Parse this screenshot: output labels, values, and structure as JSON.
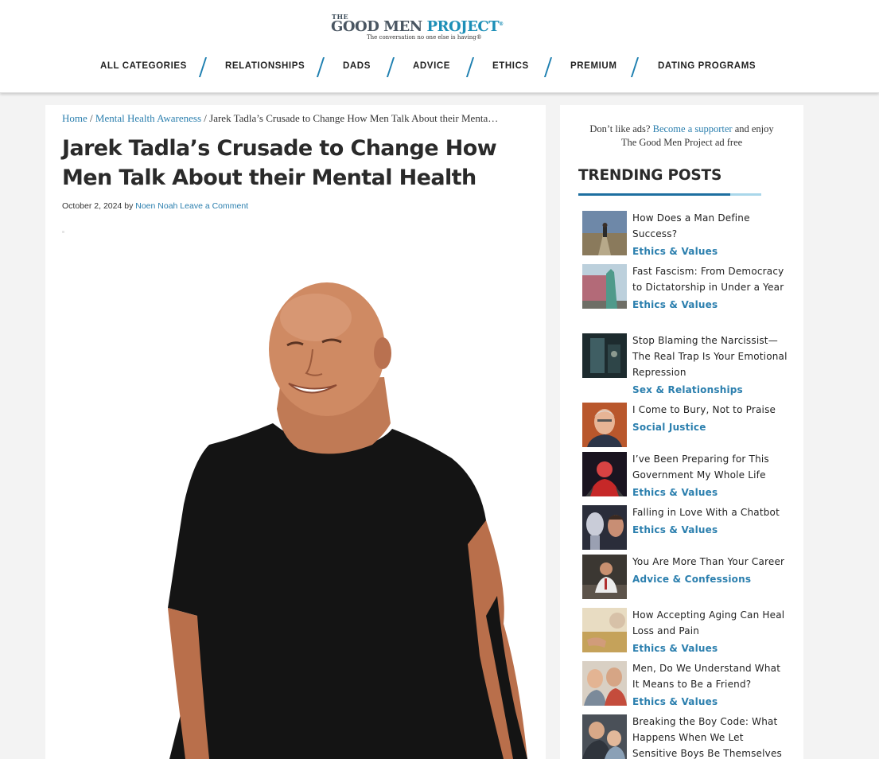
{
  "logo": {
    "word_the": "THE",
    "word_good_men": "GOOD MEN",
    "word_project": "PROJECT",
    "registered": "®",
    "tagline": "The conversation no one else is having®"
  },
  "nav": {
    "items": [
      {
        "label": "ALL CATEGORIES"
      },
      {
        "label": "RELATIONSHIPS"
      },
      {
        "label": "DADS"
      },
      {
        "label": "ADVICE"
      },
      {
        "label": "ETHICS"
      },
      {
        "label": "PREMIUM"
      },
      {
        "label": "DATING PROGRAMS"
      }
    ]
  },
  "breadcrumb": {
    "home": "Home",
    "sep": " / ",
    "category": "Mental Health Awareness",
    "current": "Jarek Tadla’s Crusade to Change How Men Talk About their Menta…"
  },
  "article": {
    "title": "Jarek Tadla’s Crusade to Change How Men Talk About their Mental Health",
    "date": "October 2, 2024",
    "by": "by",
    "author": "Noen Noah",
    "comment_link": "Leave a Comment"
  },
  "sidebar": {
    "ads_prefix": "Don’t like ads?",
    "ads_link": "Become a supporter",
    "ads_suffix": "and enjoy",
    "ads_line2": "The Good Men Project ad free",
    "trending_heading": "TRENDING POSTS",
    "posts": [
      {
        "title": "How Does a Man Define Success?",
        "category": "Ethics & Values",
        "thumb": "man-road-icon"
      },
      {
        "title": "Fast Fascism: From Democracy to Dictatorship in Under a Year",
        "category": "Ethics & Values",
        "thumb": "liberty-statue-icon"
      },
      {
        "title": "Stop Blaming the Narcissist—The Real Trap Is Your Emotional Repression",
        "category": "Sex & Relationships",
        "thumb": "doorway-icon"
      },
      {
        "title": "I Come to Bury, Not to Praise",
        "category": "Social Justice",
        "thumb": "older-man-portrait-icon"
      },
      {
        "title": "I’ve Been Preparing for This Government My Whole Life",
        "category": "Ethics & Values",
        "thumb": "red-figure-icon"
      },
      {
        "title": "Falling in Love With a Chatbot",
        "category": "Ethics & Values",
        "thumb": "robot-face-icon"
      },
      {
        "title": "You Are More Than Your Career",
        "category": "Advice & Confessions",
        "thumb": "office-man-icon"
      },
      {
        "title": "How Accepting Aging Can Heal Loss and Pain",
        "category": "Ethics & Values",
        "thumb": "aging-hands-icon"
      },
      {
        "title": "Men, Do We Understand What It Means to Be a Friend?",
        "category": "Ethics & Values",
        "thumb": "friends-laughing-icon"
      },
      {
        "title": "Breaking the Boy Code: What Happens When We Let Sensitive Boys Be Themselves",
        "category": "",
        "thumb": "boy-hug-icon"
      }
    ]
  }
}
